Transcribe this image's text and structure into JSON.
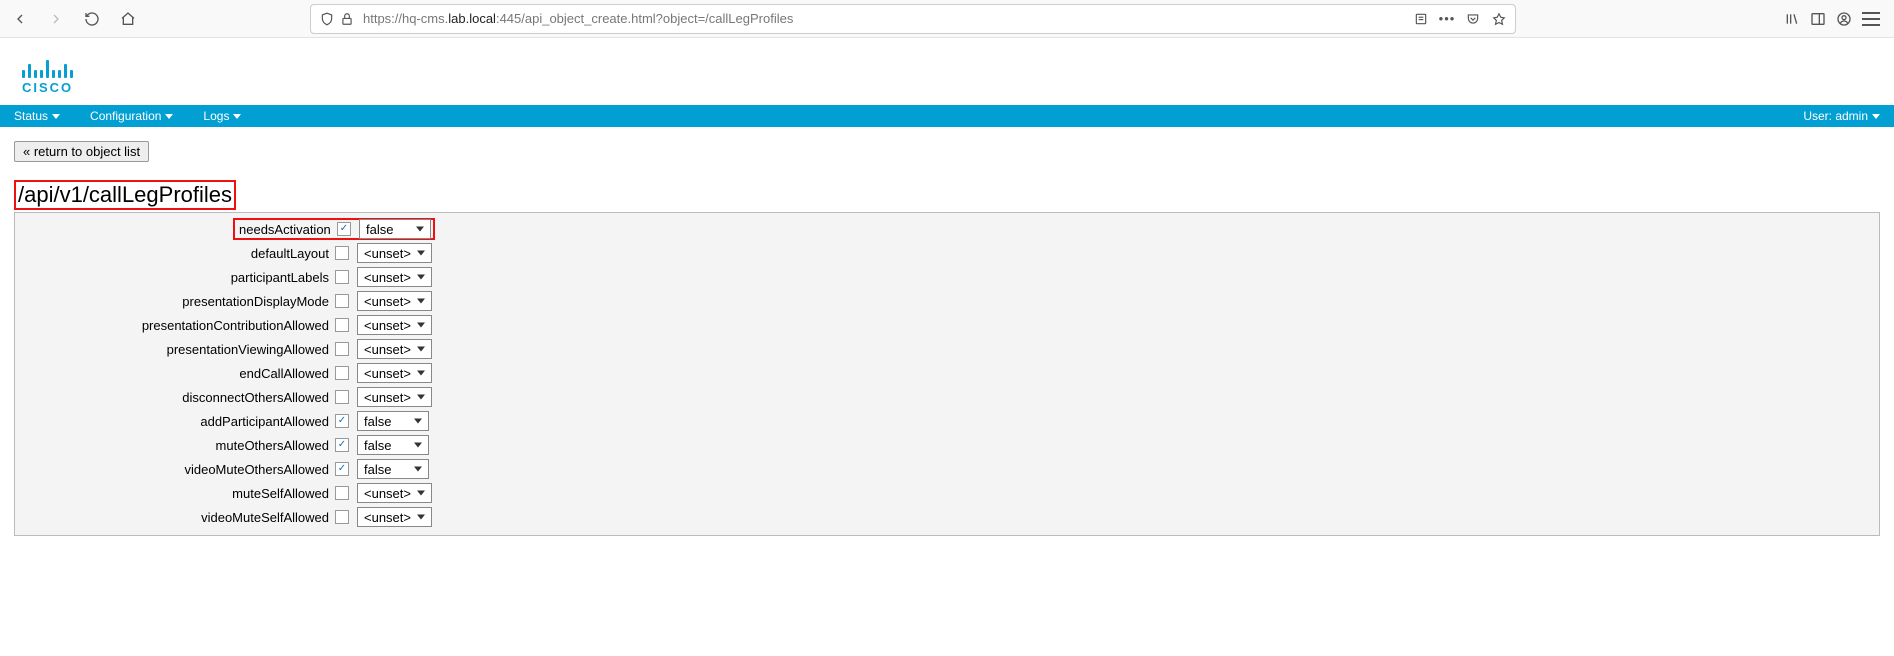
{
  "browser": {
    "url_prefix": "https://hq-cms.",
    "url_host": "lab.local",
    "url_suffix": ":445/api_object_create.html?object=/callLegProfiles"
  },
  "nav": {
    "items": [
      "Status",
      "Configuration",
      "Logs"
    ],
    "user_label": "User: admin"
  },
  "brand": {
    "name": "CISCO"
  },
  "back_label": "« return to object list",
  "api_title": "/api/v1/callLegProfiles",
  "unset_label": "<unset>",
  "rows": [
    {
      "label": "needsActivation",
      "checked": true,
      "value": "false",
      "width": "w80",
      "highlight": true
    },
    {
      "label": "defaultLayout",
      "checked": false,
      "value": "<unset>",
      "width": "w148"
    },
    {
      "label": "participantLabels",
      "checked": false,
      "value": "<unset>",
      "width": "w80"
    },
    {
      "label": "presentationDisplayMode",
      "checked": false,
      "value": "<unset>",
      "width": "w100"
    },
    {
      "label": "presentationContributionAllowed",
      "checked": false,
      "value": "<unset>",
      "width": "w80"
    },
    {
      "label": "presentationViewingAllowed",
      "checked": false,
      "value": "<unset>",
      "width": "w80"
    },
    {
      "label": "endCallAllowed",
      "checked": false,
      "value": "<unset>",
      "width": "w80"
    },
    {
      "label": "disconnectOthersAllowed",
      "checked": false,
      "value": "<unset>",
      "width": "w80"
    },
    {
      "label": "addParticipantAllowed",
      "checked": true,
      "value": "false",
      "width": "w80"
    },
    {
      "label": "muteOthersAllowed",
      "checked": true,
      "value": "false",
      "width": "w80"
    },
    {
      "label": "videoMuteOthersAllowed",
      "checked": true,
      "value": "false",
      "width": "w80"
    },
    {
      "label": "muteSelfAllowed",
      "checked": false,
      "value": "<unset>",
      "width": "w80"
    },
    {
      "label": "videoMuteSelfAllowed",
      "checked": false,
      "value": "<unset>",
      "width": "w80"
    }
  ]
}
